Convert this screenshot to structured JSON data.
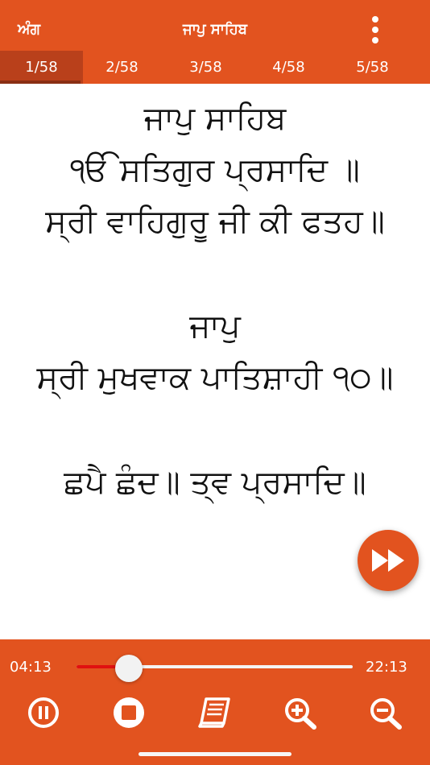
{
  "header": {
    "left_label": "ਅੰਗ",
    "title": "ਜਾਪੁ ਸਾਹਿਬ",
    "menu_icon": "more-vertical-icon"
  },
  "tabs": [
    {
      "label": "1/58",
      "active": true
    },
    {
      "label": "2/58",
      "active": false
    },
    {
      "label": "3/58",
      "active": false
    },
    {
      "label": "4/58",
      "active": false
    },
    {
      "label": "5/58",
      "active": false
    }
  ],
  "content": {
    "lines": [
      "ਜਾਪੁ ਸਾਹਿਬ",
      "ੴ ਸਤਿਗੁਰ ਪ੍ਰਸਾਦਿ ॥",
      "ਸ੍ਰੀ ਵਾਹਿਗੁਰੂ ਜੀ ਕੀ ਫਤਹ॥",
      "ਜਾਪੁ",
      "ਸ੍ਰੀ ਮੁਖਵਾਕ ਪਾਤਿਸ਼ਾਹੀ ੧੦॥",
      "ਛਪੈ ਛੰਦ॥ ਤ੍ਵ ਪ੍ਰਸਾਦਿ॥"
    ]
  },
  "fab": {
    "icon": "fast-forward-icon"
  },
  "player": {
    "elapsed": "04:13",
    "total": "22:13",
    "progress_fraction": 0.19,
    "controls": [
      "pause-icon",
      "stop-icon",
      "book-icon",
      "zoom-in-icon",
      "zoom-out-icon"
    ]
  },
  "colors": {
    "accent": "#e2531f",
    "tab_active": "#b9401b",
    "progress": "#e01010"
  }
}
